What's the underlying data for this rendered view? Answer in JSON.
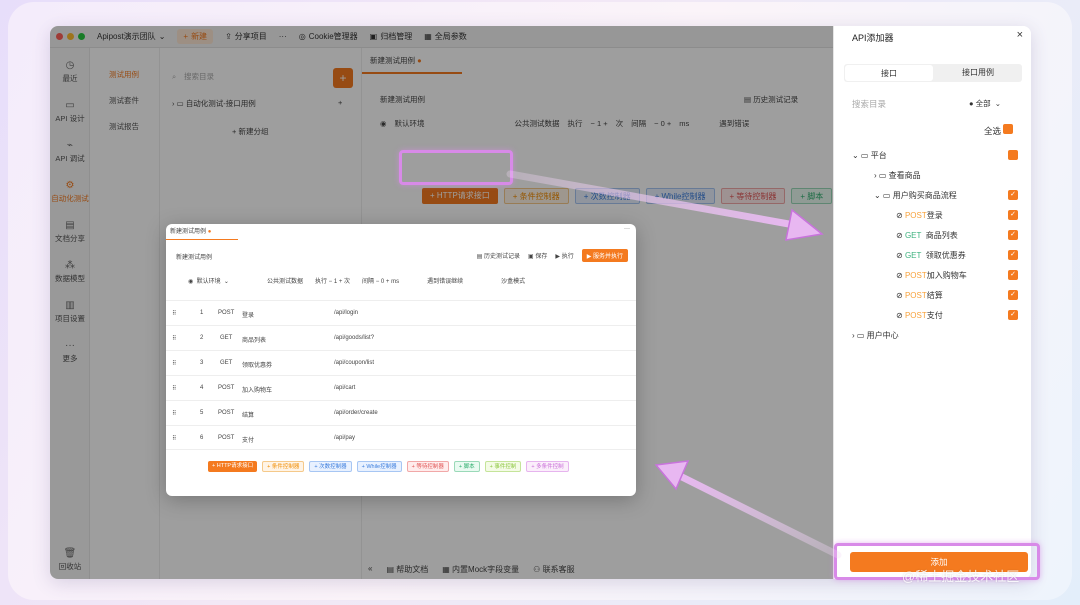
{
  "titlebar": {
    "team": "Apipost演示团队",
    "new": "新建",
    "share": "分享项目",
    "more": "···",
    "cookie": "Cookie管理器",
    "archive": "归档管理",
    "global": "全局参数"
  },
  "leftnav": {
    "items": [
      "最近",
      "API 设计",
      "API 调试",
      "自动化测试",
      "文档分享",
      "数据模型",
      "项目设置",
      "更多"
    ],
    "recycle": "回收站"
  },
  "subnav": {
    "items": [
      "测试用例",
      "测试套件",
      "测试报告"
    ]
  },
  "tree": {
    "search": "搜索目录",
    "folder": "自动化测试-接口用例",
    "add_group": "+ 新建分组"
  },
  "main": {
    "tab": "新建测试用例",
    "title": "新建测试用例",
    "history": "历史测试记录",
    "env": "默认环境",
    "public": "公共测试数据",
    "exec_label": "执行",
    "exec_count": "1",
    "exec_unit": "次",
    "interval_label": "间隔",
    "interval_value": "0",
    "interval_unit": "ms",
    "error_label": "遇到错误",
    "buttons": [
      "+ HTTP请求接口",
      "+ 条件控制器",
      "+ 次数控制器",
      "+ While控制器",
      "+ 等待控制器",
      "+ 脚本"
    ],
    "bottom": [
      "«",
      "帮助文档",
      "内置Mock字段变量",
      "联系客服"
    ]
  },
  "panel": {
    "title": "API添加器",
    "close": "×",
    "tabs": [
      "接口",
      "接口用例"
    ],
    "search": "搜索目录",
    "filter": "● 全部",
    "select_all": "全选",
    "tree": [
      {
        "label": "平台"
      },
      {
        "label": "查看商品"
      },
      {
        "label": "用户购买商品流程"
      },
      {
        "method": "POST",
        "label": "登录"
      },
      {
        "method": "GET",
        "label": "商品列表"
      },
      {
        "method": "GET",
        "label": "领取优惠券"
      },
      {
        "method": "POST",
        "label": "加入购物车"
      },
      {
        "method": "POST",
        "label": "结算"
      },
      {
        "method": "POST",
        "label": "支付"
      },
      {
        "label": "用户中心"
      }
    ],
    "add": "添加"
  },
  "preview": {
    "tab": "新建测试用例",
    "title": "新建测试用例",
    "history": "历史测试记录",
    "save": "保存",
    "run": "▶ 执行",
    "run_all": "▶ 服务并执行",
    "env": "默认环境",
    "public": "公共测试数据",
    "exec": "执行",
    "exec_count": "1",
    "exec_unit": "次",
    "interval": "间隔",
    "interval_value": "0",
    "interval_unit": "ms",
    "error": "遇到错误继续",
    "sandbox": "沙盒模式",
    "rows": [
      {
        "n": "1",
        "method": "POST",
        "name": "登录",
        "path": "/api/login"
      },
      {
        "n": "2",
        "method": "GET",
        "name": "商品列表",
        "path": "/api/goods/list?"
      },
      {
        "n": "3",
        "method": "GET",
        "name": "领取优惠券",
        "path": "/api/coupon/list"
      },
      {
        "n": "4",
        "method": "POST",
        "name": "加入购物车",
        "path": "/api/cart"
      },
      {
        "n": "5",
        "method": "POST",
        "name": "结算",
        "path": "/api/order/create"
      },
      {
        "n": "6",
        "method": "POST",
        "name": "支付",
        "path": "/api/pay"
      }
    ],
    "buttons": [
      "+ HTTP请求接口",
      "+ 条件控制器",
      "+ 次数控制器",
      "+ While控制器",
      "+ 等待控制器",
      "+ 脚本",
      "+ 事件控制",
      "+ 多条件控制"
    ]
  },
  "watermark": "@稀土掘金技术社区",
  "colors": {
    "accent": "#f47a1f",
    "highlight": "#d88ae8",
    "post": "#f7a23c",
    "get": "#3fb27f"
  }
}
